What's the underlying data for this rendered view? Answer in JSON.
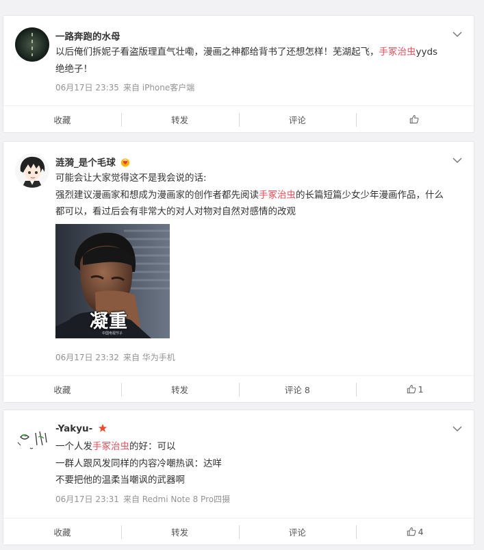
{
  "posts": [
    {
      "username": "一路奔跑的水母",
      "lines": [
        [
          {
            "text": "以后俺们拆妮子看盗版理直气壮嘞，漫画之神都给背书了还想怎样！芜湖起飞，"
          },
          {
            "text": "手冢治虫",
            "hl": true
          },
          {
            "text": "yyds"
          }
        ],
        [
          {
            "text": "绝绝子！"
          }
        ]
      ],
      "time": "06月17日 23:35",
      "source": "来自 iPhone客户端",
      "actions": {
        "collect": "收藏",
        "repost": "转发",
        "comment": "评论",
        "like_count": ""
      }
    },
    {
      "username": "涟漪_是个毛球",
      "badge": "crown-heart-badge",
      "lines": [
        [
          {
            "text": "可能会让大家觉得这不是我会说的话:"
          }
        ],
        [
          {
            "text": "强烈建议漫画家和想成为漫画家的创作者都先阅读"
          },
          {
            "text": "手冢治虫",
            "hl": true
          },
          {
            "text": "的长篇短篇少女少年漫画作品，什么"
          }
        ],
        [
          {
            "text": "都可以，看过后会有非常大的对人对物对自然对感情的改观"
          }
        ]
      ],
      "image": {
        "caption": "凝重",
        "watermark": "中国电视节子"
      },
      "time": "06月17日 23:32",
      "source": "来自 华为手机",
      "actions": {
        "collect": "收藏",
        "repost": "转发",
        "comment": "评论 8",
        "like_count": "1"
      }
    },
    {
      "username": "-Yakyu-",
      "badge": "star-badge",
      "lines": [
        [
          {
            "text": "一个人发"
          },
          {
            "text": "手冢治虫",
            "hl": true
          },
          {
            "text": "的好：可以"
          }
        ],
        [
          {
            "text": "一群人跟风发同样的内容冷嘲热讽：达咩"
          }
        ],
        [
          {
            "text": "不要把他的温柔当嘲讽的武器啊"
          }
        ]
      ],
      "time": "06月17日 23:31",
      "source": "来自 Redmi Note 8 Pro四摄",
      "actions": {
        "collect": "收藏",
        "repost": "转发",
        "comment": "评论",
        "like_count": "4"
      }
    }
  ],
  "colors": {
    "highlight": "#eb4d5a",
    "meta": "#939393",
    "background": "#f2f2f5"
  }
}
